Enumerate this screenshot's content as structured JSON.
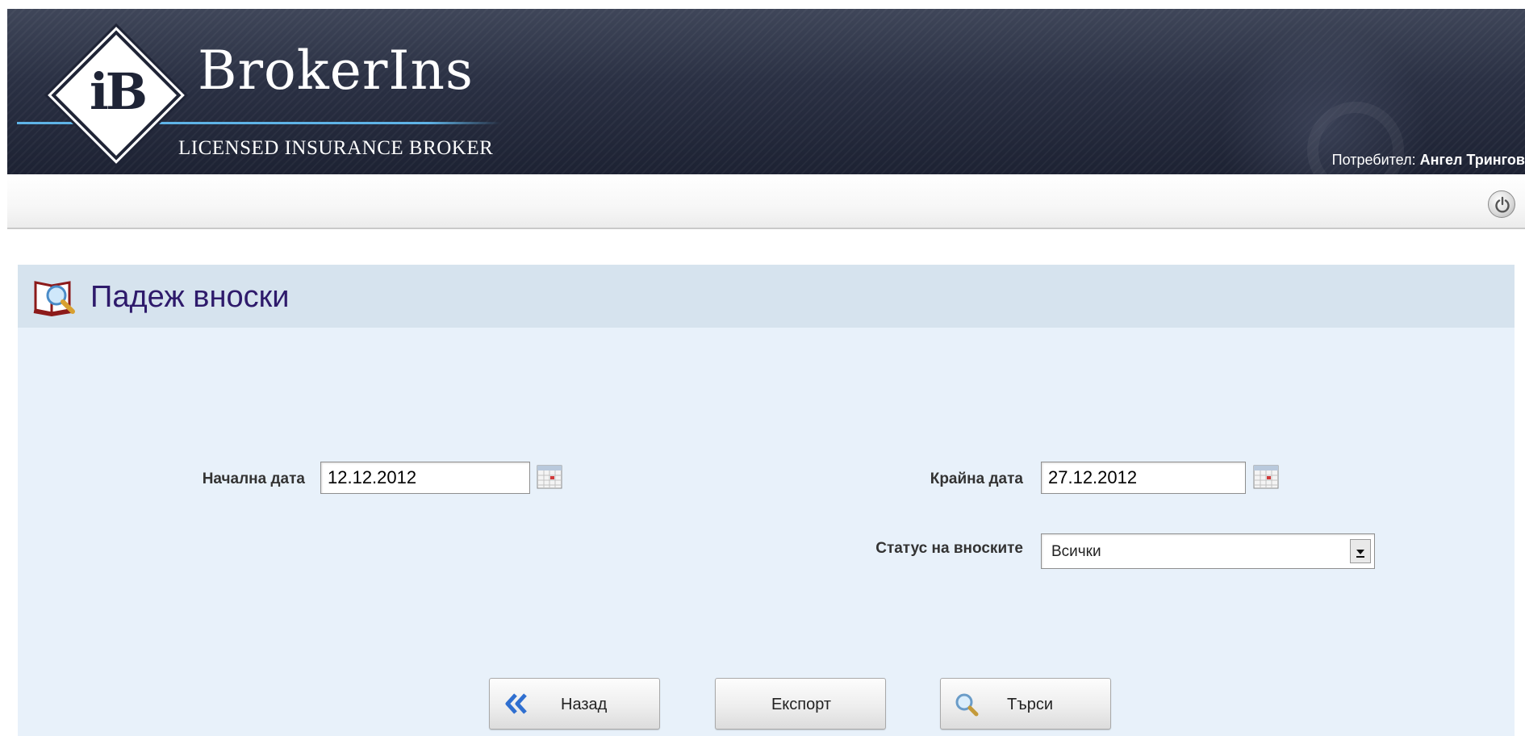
{
  "header": {
    "brand_mark": "iB",
    "brand_name": "BrokerIns",
    "brand_tagline": "LICENSED INSURANCE BROKER",
    "user_label": "Потребител:",
    "user_name": "Ангел Трингов"
  },
  "toolbar": {
    "power_icon": "power-icon"
  },
  "page": {
    "title": "Падеж вноски",
    "title_icon": "book-search-icon"
  },
  "form": {
    "start_date": {
      "label": "Начална дата",
      "value": "12.12.2012",
      "icon": "calendar-icon"
    },
    "end_date": {
      "label": "Крайна дата",
      "value": "27.12.2012",
      "icon": "calendar-icon"
    },
    "status": {
      "label": "Статус на вноските",
      "selected": "Всички"
    }
  },
  "buttons": {
    "back": {
      "label": "Назад",
      "icon": "double-chevron-left-icon"
    },
    "export": {
      "label": "Експорт"
    },
    "search": {
      "label": "Търси",
      "icon": "magnifier-icon"
    }
  },
  "colors": {
    "header_bg": "#2a3043",
    "panel_bg": "#e8f1fa",
    "panel_head_bg": "#d6e3ee",
    "title_color": "#2e1a6b",
    "accent_line": "#5fb3e6"
  }
}
